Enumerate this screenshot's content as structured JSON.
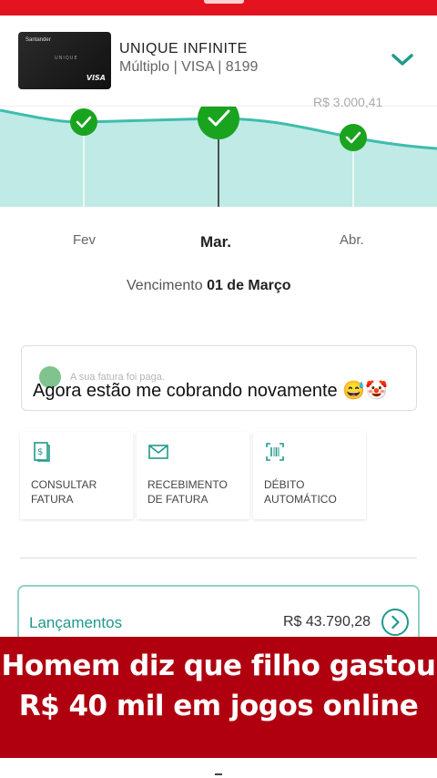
{
  "card": {
    "title": "UNIQUE INFINITE",
    "subtitle": "Múltiplo | VISA | 8199",
    "thumb_brand": "Santander",
    "thumb_name": "UNIQUE",
    "thumb_network": "VISA"
  },
  "chart": {
    "partial_label": "R$ 3.000,41",
    "months": [
      "Fev",
      "Mar.",
      "Abr."
    ],
    "selected_month": "Mar.",
    "accent": "#1aa31f",
    "fill": "#bfeae5"
  },
  "due": {
    "label": "Vencimento",
    "date": "01 de Março"
  },
  "notice": {
    "small_text": "A sua fatura foi paga.",
    "big_text": "Agora estão me cobrando novamente 😅🤡"
  },
  "actions": [
    {
      "icon": "document-dollar-icon",
      "label_1": "CONSULTAR",
      "label_2": "FATURA"
    },
    {
      "icon": "envelope-icon",
      "label_1": "RECEBIMENTO",
      "label_2": "DE FATURA"
    },
    {
      "icon": "barcode-icon",
      "label_1": "DÉBITO",
      "label_2": "AUTOMÁTICO"
    }
  ],
  "lancamentos": {
    "title": "Lançamentos",
    "value": "R$ 43.790,28"
  },
  "caption": {
    "line1": "Homem diz que filho gastou",
    "line2": "R$ 40 mil em jogos online"
  }
}
